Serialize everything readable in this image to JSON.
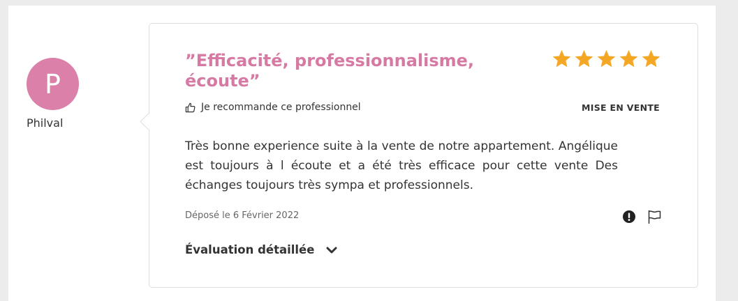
{
  "reviewer": {
    "initial": "P",
    "name": "Philval",
    "avatar_color": "#db80a8"
  },
  "review": {
    "title": "”Efficacité, professionnalisme, écoute”",
    "rating": 5,
    "rating_max": 5,
    "star_color": "#f5a623",
    "recommend_text": "Je recommande ce professionnel",
    "category": "MISE EN VENTE",
    "body": "Très bonne experience suite à la vente de notre appartement. Angélique est toujours à l écoute et a été très efficace pour cette vente Des échanges toujours très sympa et professionnels.",
    "date": "Déposé le 6 Février 2022",
    "detailed_label": "Évaluation détaillée",
    "accent_color": "#d67aa4"
  },
  "icons": {
    "recommend": "thumbs-up-icon",
    "report": "exclamation-circle-icon",
    "flag": "flag-icon",
    "expand": "chevron-down-icon",
    "star": "star-icon"
  }
}
